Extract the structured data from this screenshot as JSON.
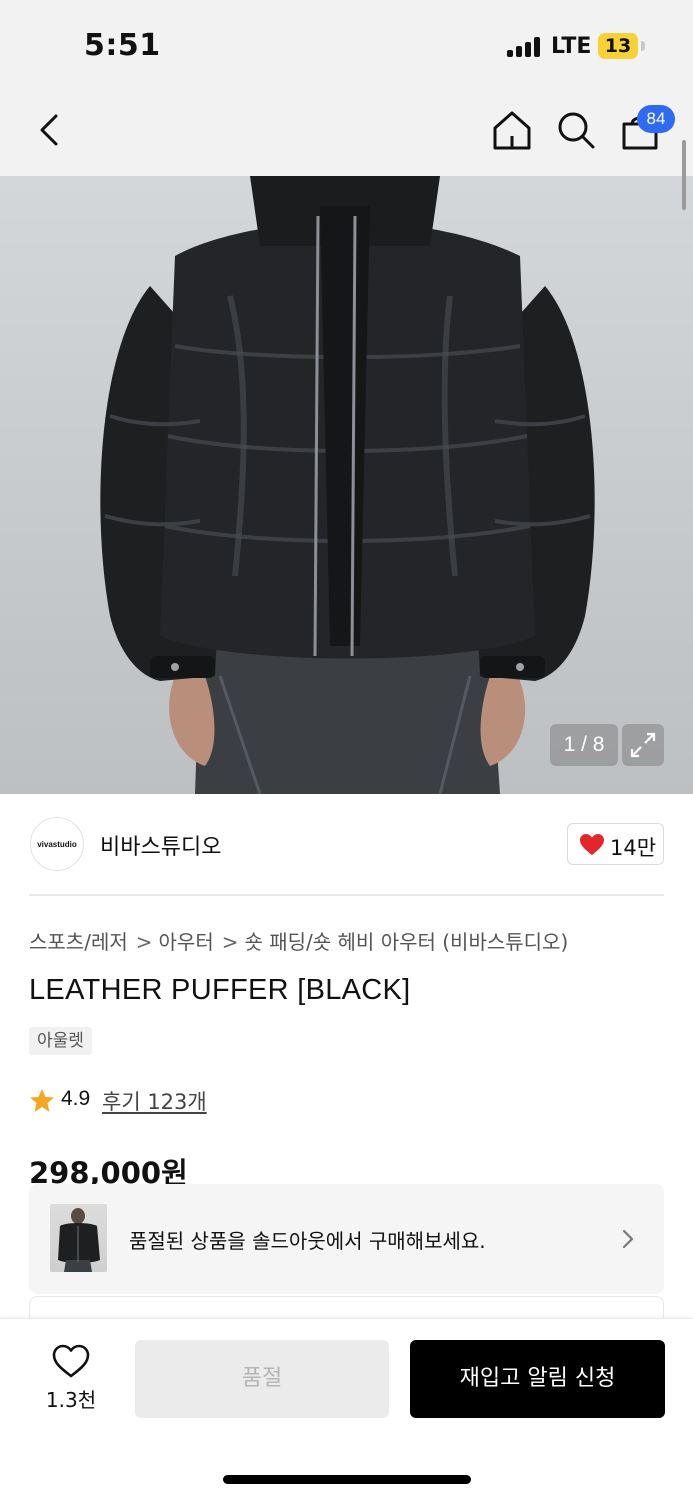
{
  "status_bar": {
    "time": "5:51",
    "network": "LTE",
    "battery": "13"
  },
  "nav": {
    "cart_count": "84"
  },
  "gallery": {
    "counter": "1 / 8"
  },
  "brand": {
    "logo_text": "vivastudio",
    "name": "비바스튜디오",
    "likes": "14만"
  },
  "breadcrumb": [
    "스포츠/레저",
    "아우터",
    "숏 패딩/숏 헤비 아우터 (비바스튜디오)"
  ],
  "product": {
    "title": "LEATHER PUFFER [BLACK]",
    "tag": "아울렛",
    "rating": "4.9",
    "reviews": "후기 123개",
    "price": "298,000원"
  },
  "soldout_banner": {
    "text": "품절된 상품을 솔드아웃에서 구매해보세요."
  },
  "bottom_bar": {
    "wish_count": "1.3천",
    "soldout_label": "품절",
    "restock_label": "재입고 알림 신청"
  },
  "colors": {
    "accent_blue": "#2f6bf2",
    "heart_red": "#e3262c",
    "star_orange": "#f5a623",
    "battery_yellow": "#f7d235"
  }
}
